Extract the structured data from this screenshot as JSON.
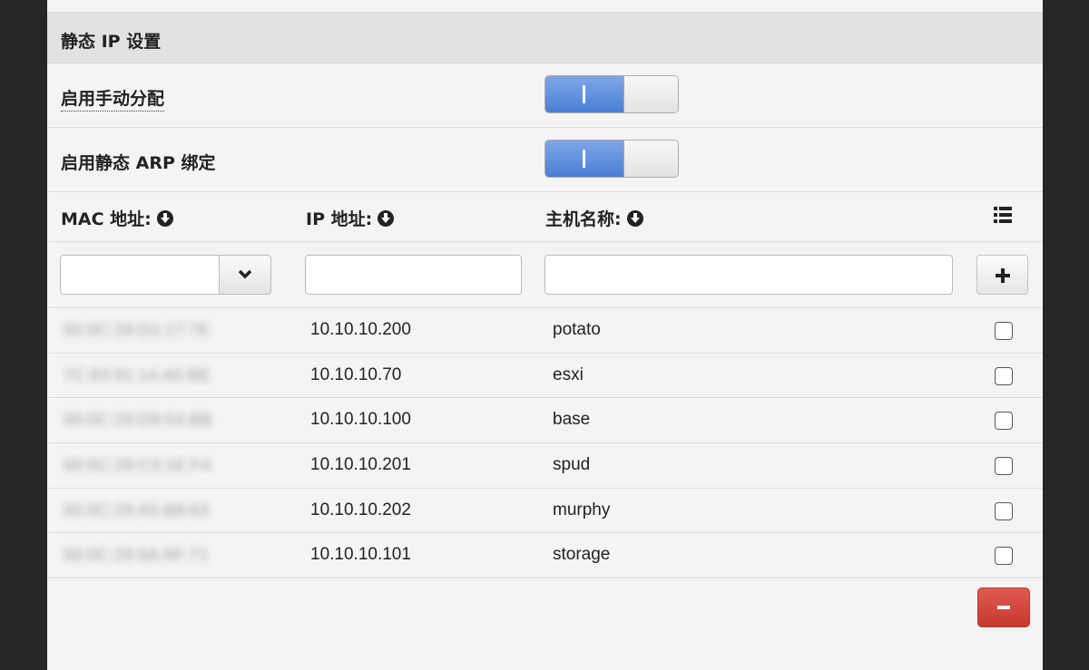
{
  "section": {
    "title": "静态 IP 设置"
  },
  "settings": [
    {
      "label": "启用手动分配",
      "enabled": true
    },
    {
      "label": "启用静态 ARP 绑定",
      "enabled": true
    }
  ],
  "table": {
    "headers": {
      "mac": "MAC 地址:",
      "ip": "IP 地址:",
      "hostname": "主机名称:"
    },
    "inputs": {
      "mac_value": "",
      "ip_value": "",
      "hostname_value": ""
    },
    "rows": [
      {
        "mac": "00:0C:29:D1:17:7E",
        "ip": "10.10.10.200",
        "hostname": "potato",
        "checked": false
      },
      {
        "mac": "7C:83:91:14:A5:BE",
        "ip": "10.10.10.70",
        "hostname": "esxi",
        "checked": false
      },
      {
        "mac": "00:0C:29:D9:54:BB",
        "ip": "10.10.10.100",
        "hostname": "base",
        "checked": false
      },
      {
        "mac": "00:0C:29:C3:1E:F4",
        "ip": "10.10.10.201",
        "hostname": "spud",
        "checked": false
      },
      {
        "mac": "00:0C:29:A5:B8:63",
        "ip": "10.10.10.202",
        "hostname": "murphy",
        "checked": false
      },
      {
        "mac": "00:0C:29:6A:6F:71",
        "ip": "10.10.10.101",
        "hostname": "storage",
        "checked": false
      }
    ]
  },
  "icons": {
    "sort": "sort-down-circle-icon",
    "columns": "list-icon",
    "dropdown": "chevron-down-icon",
    "add": "plus-icon",
    "remove": "minus-icon"
  },
  "colors": {
    "toggle_on": "#4a7fd6",
    "remove_button": "#c53a30",
    "header_bg": "#e2e2e2",
    "panel_bg": "#f4f4f4",
    "outer_bg": "#262626"
  }
}
